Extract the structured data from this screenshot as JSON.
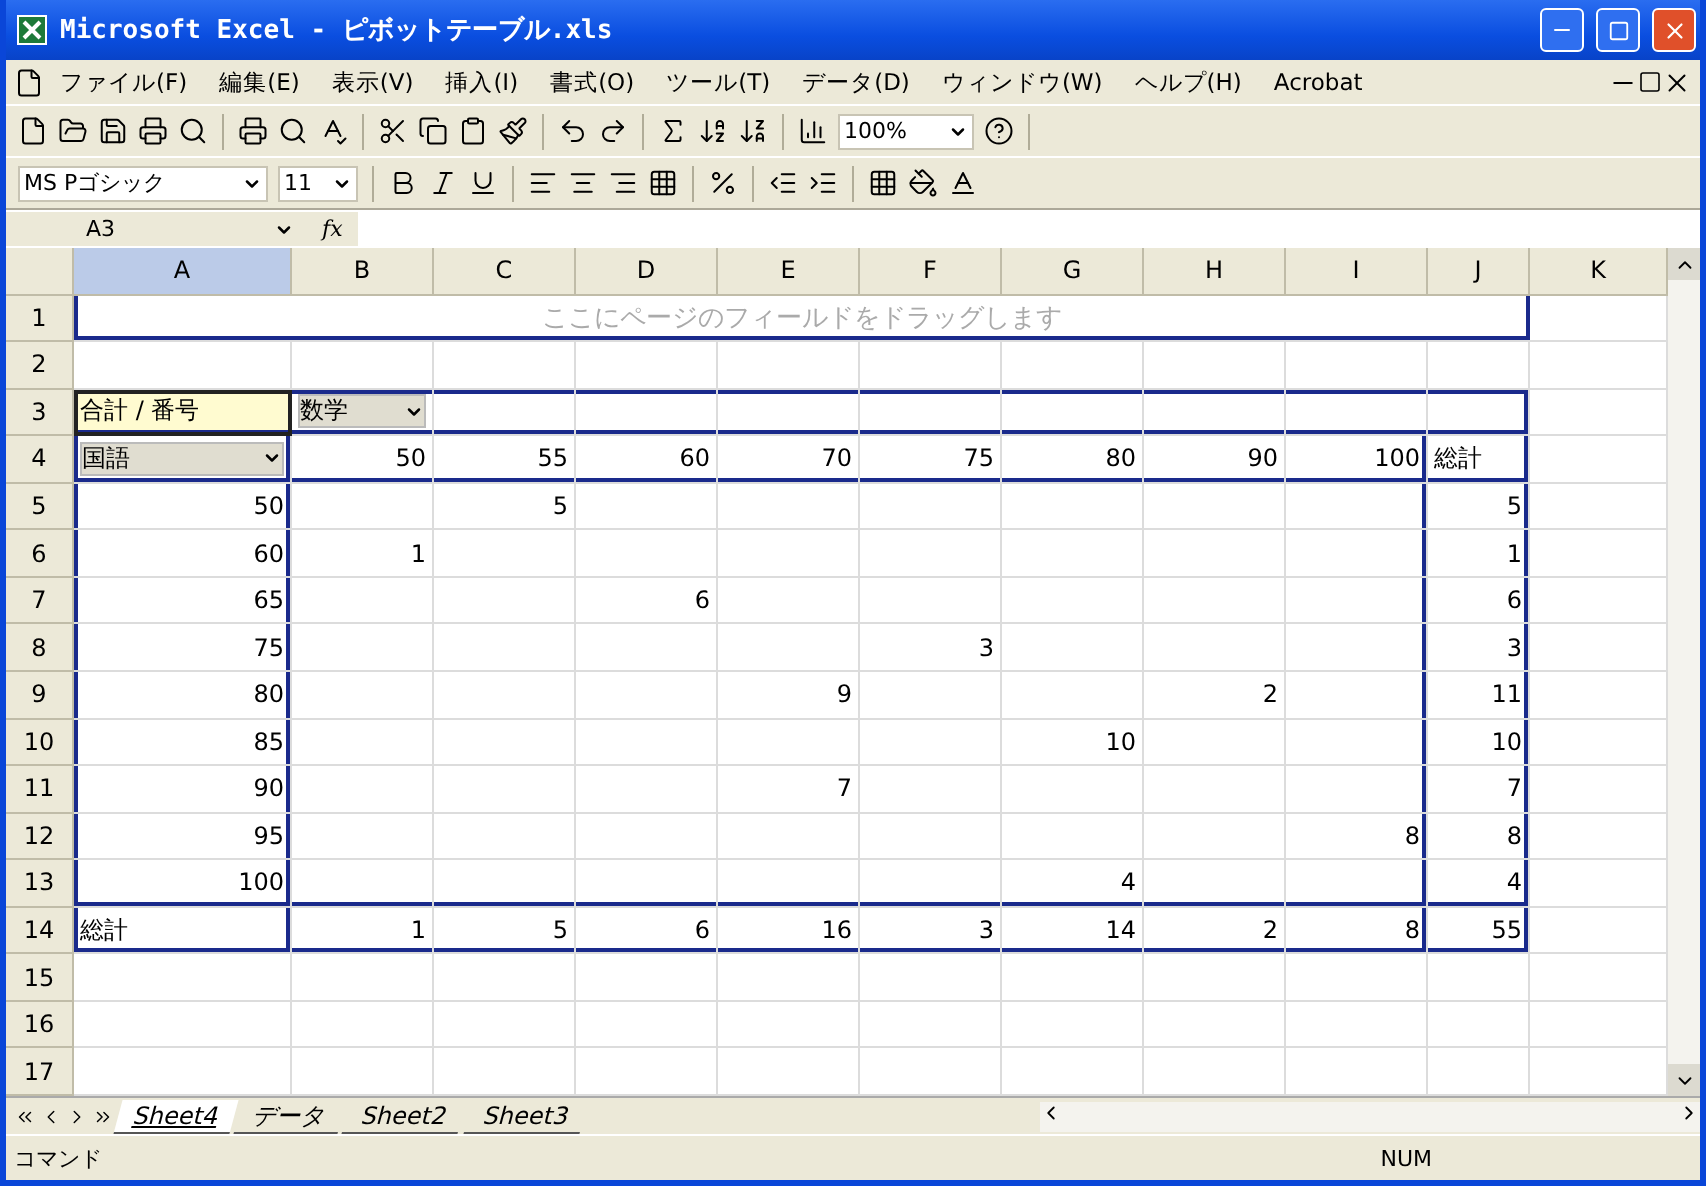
{
  "window": {
    "title": "Microsoft Excel - ピボットテーブル.xls"
  },
  "menu": [
    "ファイル(F)",
    "編集(E)",
    "表示(V)",
    "挿入(I)",
    "書式(O)",
    "ツール(T)",
    "データ(D)",
    "ウィンドウ(W)",
    "ヘルプ(H)",
    "Acrobat"
  ],
  "toolbar": {
    "zoom": "100%",
    "font": "MS Pゴシック",
    "size": "11"
  },
  "formula_bar": {
    "name_box": "A3",
    "fx": "fx"
  },
  "columns": [
    {
      "label": "A",
      "selected": true
    },
    {
      "label": "B",
      "selected": false
    },
    {
      "label": "C",
      "selected": false
    },
    {
      "label": "D",
      "selected": false
    },
    {
      "label": "E",
      "selected": false
    },
    {
      "label": "F",
      "selected": false
    },
    {
      "label": "G",
      "selected": false
    },
    {
      "label": "H",
      "selected": false
    },
    {
      "label": "I",
      "selected": false
    },
    {
      "label": "J",
      "selected": false
    },
    {
      "label": "K",
      "selected": false
    }
  ],
  "rows": [
    {
      "label": "1",
      "hint": "ここにページのフィールドをドラッグします"
    },
    {
      "label": "2",
      "cells": []
    },
    {
      "label": "3",
      "cells": [
        {
          "text": "合計 / 番号",
          "kind": "label",
          "selected": true
        },
        {
          "text": "数学",
          "kind": "field",
          "selected": false
        }
      ]
    },
    {
      "label": "4",
      "cells": [
        {
          "text": "国語",
          "kind": "field",
          "selected": false
        },
        {
          "text": "50",
          "kind": "number",
          "selected": false
        },
        {
          "text": "55",
          "kind": "number",
          "selected": false
        },
        {
          "text": "60",
          "kind": "number",
          "selected": false
        },
        {
          "text": "70",
          "kind": "number",
          "selected": false
        },
        {
          "text": "75",
          "kind": "number",
          "selected": false
        },
        {
          "text": "80",
          "kind": "number",
          "selected": false
        },
        {
          "text": "90",
          "kind": "number",
          "selected": false
        },
        {
          "text": "100",
          "kind": "number",
          "selected": false
        },
        {
          "text": "総計",
          "kind": "label",
          "selected": false
        }
      ]
    },
    {
      "label": "5",
      "cells": [
        {
          "text": "50",
          "kind": "number",
          "selected": false
        },
        null,
        {
          "text": "5",
          "kind": "number",
          "selected": false
        },
        null,
        null,
        null,
        null,
        null,
        null,
        {
          "text": "5",
          "kind": "number",
          "selected": false
        }
      ]
    },
    {
      "label": "6",
      "cells": [
        {
          "text": "60",
          "kind": "number",
          "selected": false
        },
        {
          "text": "1",
          "kind": "number",
          "selected": false
        },
        null,
        null,
        null,
        null,
        null,
        null,
        null,
        {
          "text": "1",
          "kind": "number",
          "selected": false
        }
      ]
    },
    {
      "label": "7",
      "cells": [
        {
          "text": "65",
          "kind": "number",
          "selected": false
        },
        null,
        null,
        {
          "text": "6",
          "kind": "number",
          "selected": false
        },
        null,
        null,
        null,
        null,
        null,
        {
          "text": "6",
          "kind": "number",
          "selected": false
        }
      ]
    },
    {
      "label": "8",
      "cells": [
        {
          "text": "75",
          "kind": "number",
          "selected": false
        },
        null,
        null,
        null,
        null,
        {
          "text": "3",
          "kind": "number",
          "selected": false
        },
        null,
        null,
        null,
        {
          "text": "3",
          "kind": "number",
          "selected": false
        }
      ]
    },
    {
      "label": "9",
      "cells": [
        {
          "text": "80",
          "kind": "number",
          "selected": false
        },
        null,
        null,
        null,
        {
          "text": "9",
          "kind": "number",
          "selected": false
        },
        null,
        null,
        {
          "text": "2",
          "kind": "number",
          "selected": false
        },
        null,
        {
          "text": "11",
          "kind": "number",
          "selected": false
        }
      ]
    },
    {
      "label": "10",
      "cells": [
        {
          "text": "85",
          "kind": "number",
          "selected": false
        },
        null,
        null,
        null,
        null,
        null,
        {
          "text": "10",
          "kind": "number",
          "selected": false
        },
        null,
        null,
        {
          "text": "10",
          "kind": "number",
          "selected": false
        }
      ]
    },
    {
      "label": "11",
      "cells": [
        {
          "text": "90",
          "kind": "number",
          "selected": false
        },
        null,
        null,
        null,
        {
          "text": "7",
          "kind": "number",
          "selected": false
        },
        null,
        null,
        null,
        null,
        {
          "text": "7",
          "kind": "number",
          "selected": false
        }
      ]
    },
    {
      "label": "12",
      "cells": [
        {
          "text": "95",
          "kind": "number",
          "selected": false
        },
        null,
        null,
        null,
        null,
        null,
        null,
        null,
        {
          "text": "8",
          "kind": "number",
          "selected": false
        },
        {
          "text": "8",
          "kind": "number",
          "selected": false
        }
      ]
    },
    {
      "label": "13",
      "cells": [
        {
          "text": "100",
          "kind": "number",
          "selected": false
        },
        null,
        null,
        null,
        null,
        null,
        {
          "text": "4",
          "kind": "number",
          "selected": false
        },
        null,
        null,
        {
          "text": "4",
          "kind": "number",
          "selected": false
        }
      ]
    },
    {
      "label": "14",
      "cells": [
        {
          "text": "総計",
          "kind": "label",
          "selected": false
        },
        {
          "text": "1",
          "kind": "number",
          "selected": false
        },
        {
          "text": "5",
          "kind": "number",
          "selected": false
        },
        {
          "text": "6",
          "kind": "number",
          "selected": false
        },
        {
          "text": "16",
          "kind": "number",
          "selected": false
        },
        {
          "text": "3",
          "kind": "number",
          "selected": false
        },
        {
          "text": "14",
          "kind": "number",
          "selected": false
        },
        {
          "text": "2",
          "kind": "number",
          "selected": false
        },
        {
          "text": "8",
          "kind": "number",
          "selected": false
        },
        {
          "text": "55",
          "kind": "number",
          "selected": false
        }
      ]
    },
    {
      "label": "15",
      "cells": []
    },
    {
      "label": "16",
      "cells": []
    },
    {
      "label": "17",
      "cells": []
    }
  ],
  "sheet_tabs": [
    {
      "label": "Sheet4",
      "selected": true
    },
    {
      "label": "データ",
      "selected": false
    },
    {
      "label": "Sheet2",
      "selected": false
    },
    {
      "label": "Sheet3",
      "selected": false
    }
  ],
  "status_bar": {
    "mode": "コマンド",
    "num": "NUM"
  }
}
